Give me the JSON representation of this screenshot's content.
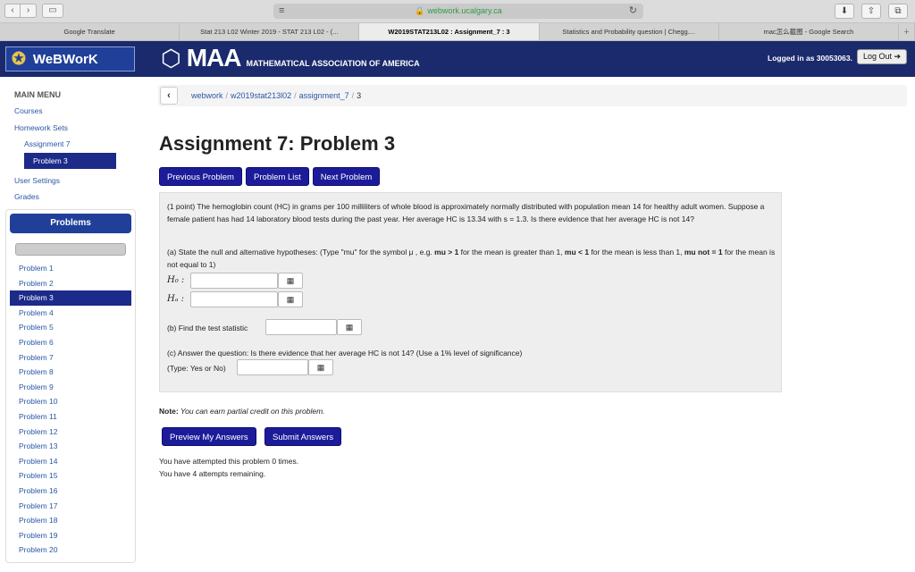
{
  "browser": {
    "url": "webwork.ucalgary.ca",
    "tabs": [
      {
        "label": "Google Translate",
        "active": false
      },
      {
        "label": "Stat 213 L02 Winter 2019 - STAT 213 L02 - (...",
        "active": false
      },
      {
        "label": "W2019STAT213L02 : Assignment_7 : 3",
        "active": true
      },
      {
        "label": "Statistics and Probability question | Chegg....",
        "active": false
      },
      {
        "label": "mac怎么截图 - Google Search",
        "active": false
      }
    ]
  },
  "header": {
    "webwork_label": "WeBWorK",
    "maa_big": "MAA",
    "maa_small": "MATHEMATICAL ASSOCIATION OF AMERICA",
    "login_text": "Logged in as 30053063.",
    "logout_label": "Log Out"
  },
  "main_menu": {
    "title": "MAIN MENU",
    "courses": "Courses",
    "homework_sets": "Homework Sets",
    "assignment": "Assignment 7",
    "problem": "Problem 3",
    "user_settings": "User Settings",
    "grades": "Grades"
  },
  "problems_panel": {
    "title": "Problems",
    "items": [
      "Problem 1",
      "Problem 2",
      "Problem 3",
      "Problem 4",
      "Problem 5",
      "Problem 6",
      "Problem 7",
      "Problem 8",
      "Problem 9",
      "Problem 10",
      "Problem 11",
      "Problem 12",
      "Problem 13",
      "Problem 14",
      "Problem 15",
      "Problem 16",
      "Problem 17",
      "Problem 18",
      "Problem 19",
      "Problem 20"
    ],
    "active_index": 2
  },
  "breadcrumb": {
    "webwork": "webwork",
    "course": "w2019stat213l02",
    "set": "assignment_7",
    "problem": "3"
  },
  "page_title": "Assignment 7: Problem 3",
  "nav_buttons": {
    "previous": "Previous Problem",
    "list": "Problem List",
    "next": "Next Problem"
  },
  "problem": {
    "intro": "(1 point) The hemoglobin count (HC) in grams per 100 milliliters of whole blood is approximately normally distributed with population mean 14 for healthy adult women. Suppose a female patient has had 14 laboratory blood tests during the past year. Her average HC is 13.34 with s = 1.3. Is there evidence that her average HC is not 14?",
    "part_a_1": "(a) State the null and alternative hypotheses: (Type \"mu\" for the symbol μ , e.g. ",
    "part_a_2": "mu > 1",
    "part_a_3": " for the mean is greater than 1, ",
    "part_a_4": "mu < 1",
    "part_a_5": " for the mean is less than 1, ",
    "part_a_6": "mu not = 1",
    "part_a_7": " for the mean is not equal to 1)",
    "h0_label": "H₀ :",
    "ha_label": "Hₐ :",
    "part_b": "(b) Find the test statistic",
    "part_c": "(c) Answer the question: Is there evidence that her average HC is not 14? (Use a 1% level of significance)",
    "part_c_type": "(Type: Yes or No)",
    "h0_value": "",
    "ha_value": "",
    "b_value": "",
    "c_value": ""
  },
  "note": {
    "label": "Note:",
    "text": " You can earn partial credit on this problem."
  },
  "submit_buttons": {
    "preview": "Preview My Answers",
    "submit": "Submit Answers"
  },
  "attempts": {
    "line1": "You have attempted this problem 0 times.",
    "line2": "You have 4 attempts remaining."
  }
}
